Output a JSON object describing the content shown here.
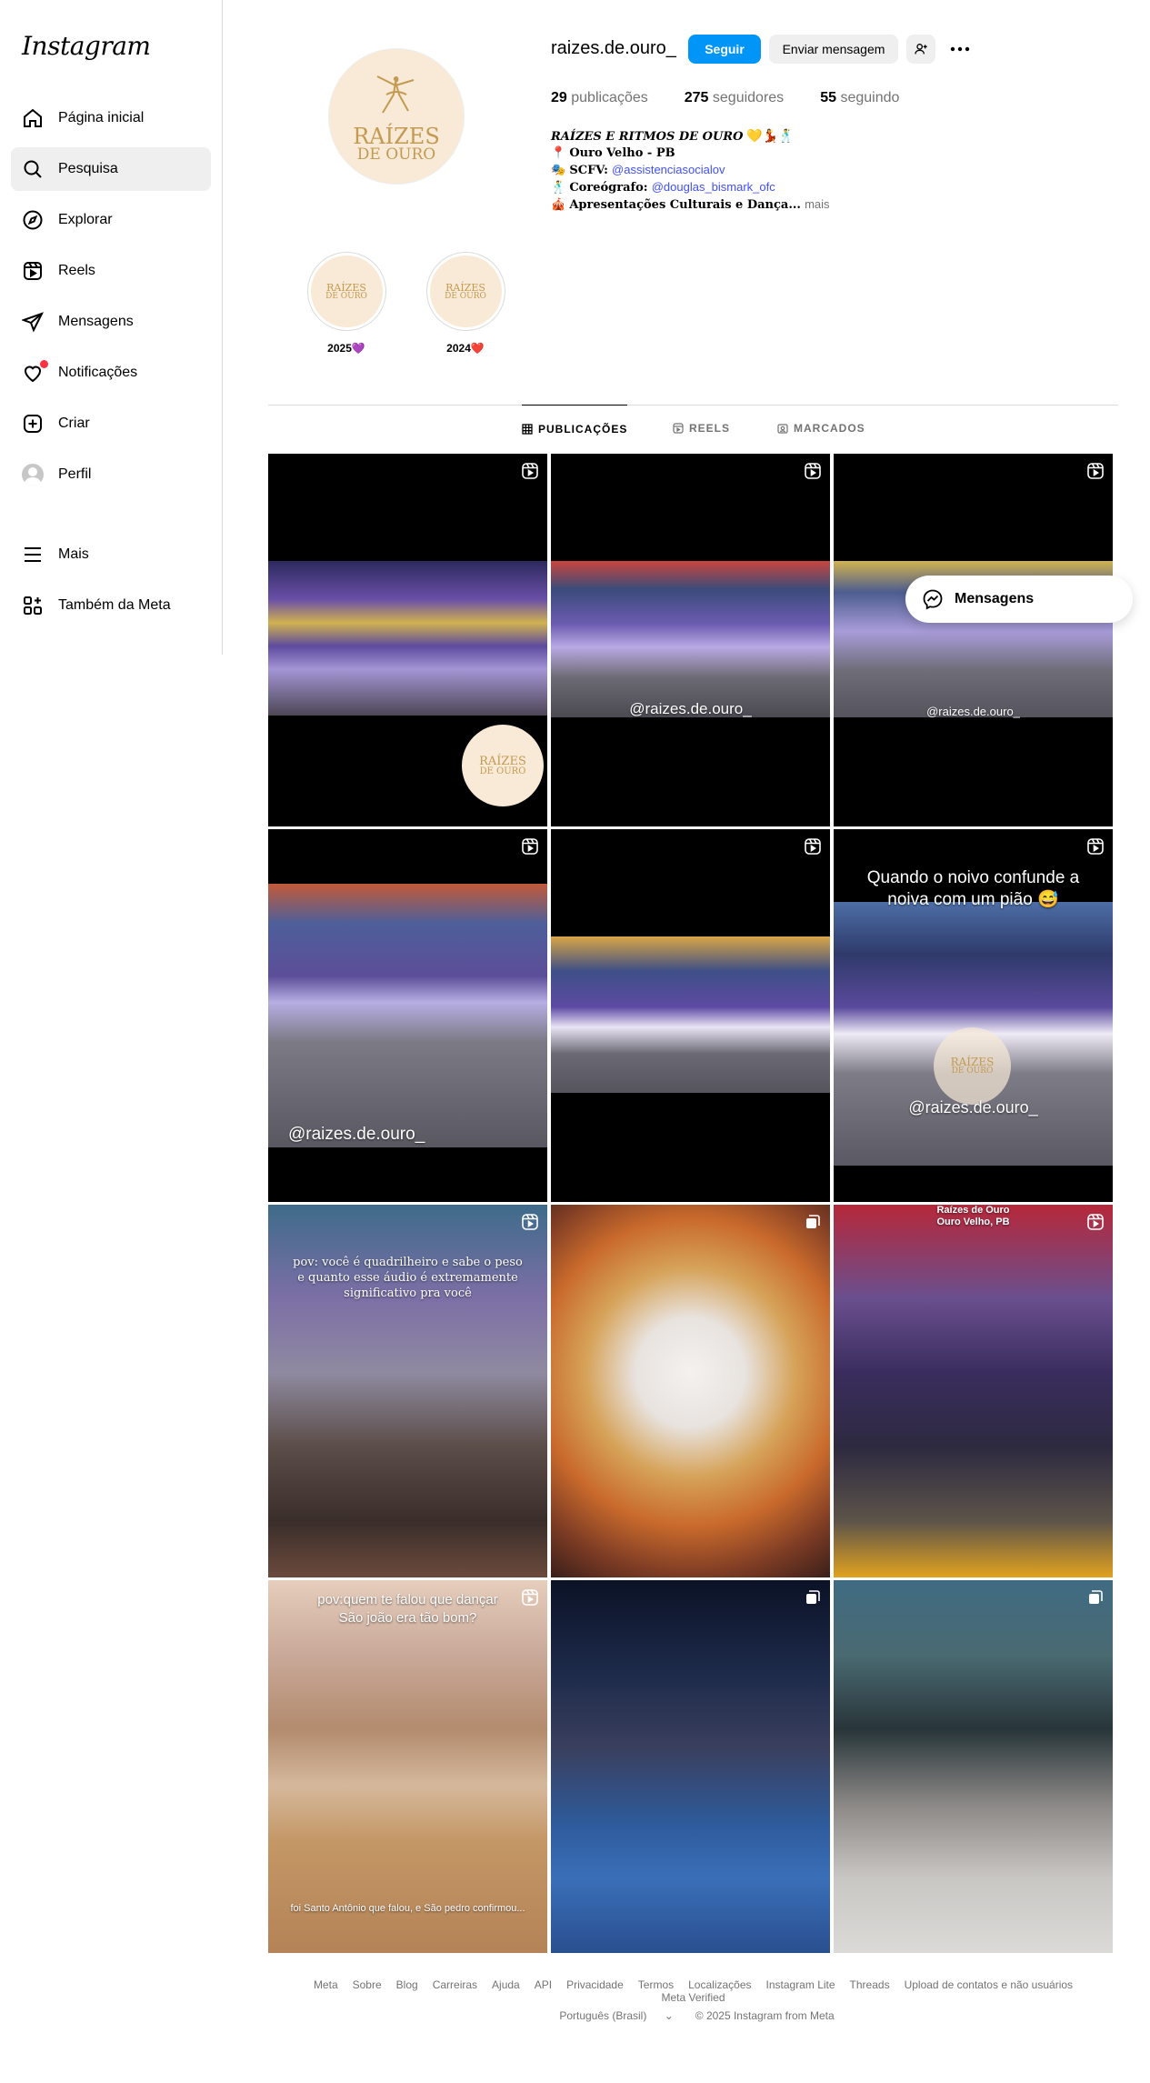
{
  "sidebar": {
    "logo": "Instagram",
    "items": [
      {
        "label": "Página inicial"
      },
      {
        "label": "Pesquisa"
      },
      {
        "label": "Explorar"
      },
      {
        "label": "Reels"
      },
      {
        "label": "Mensagens"
      },
      {
        "label": "Notificações"
      },
      {
        "label": "Criar"
      },
      {
        "label": "Perfil"
      }
    ],
    "more": "Mais",
    "meta": "Também da Meta"
  },
  "profile": {
    "username": "raizes.de.ouro_",
    "follow_label": "Seguir",
    "message_label": "Enviar mensagem",
    "stats": {
      "posts_count": "29",
      "posts_label": "publicações",
      "followers_count": "275",
      "followers_label": "seguidores",
      "following_count": "55",
      "following_label": "seguindo"
    },
    "bio": {
      "title": "RAÍZES E RITMOS DE OURO",
      "title_emojis": "💛💃🕺",
      "line1_icon": "📍",
      "line1": "Ouro Velho - PB",
      "line2_icon": "🎭",
      "line2_prefix": "SCFV:",
      "line2_link": "@assistenciasocialov",
      "line3_icon": "🕺",
      "line3_prefix": "Coreógrafo:",
      "line3_link": "@douglas_bismark_ofc",
      "line4_icon": "🎪",
      "line4": "Apresentações Culturais e Dança...",
      "more": "mais"
    },
    "emblem_line1": "RAÍZES",
    "emblem_line2": "DE OURO"
  },
  "highlights": [
    {
      "label": "2025💜"
    },
    {
      "label": "2024❤️"
    }
  ],
  "tabs": [
    {
      "label": "PUBLICAÇÕES"
    },
    {
      "label": "REELS"
    },
    {
      "label": "MARCADOS"
    }
  ],
  "posts": [
    {
      "overlay_top": "",
      "overlay_bottom": ""
    },
    {
      "overlay_top": "",
      "overlay_bottom": "@raizes.de.ouro_"
    },
    {
      "overlay_top": "",
      "overlay_bottom": "@raizes.de.ouro_"
    },
    {
      "overlay_top": "",
      "overlay_bottom": "@raizes.de.ouro_"
    },
    {
      "overlay_top": "",
      "overlay_bottom": ""
    },
    {
      "overlay_top": "Quando o noivo confunde a noiva com um pião 😅",
      "overlay_bottom": "@raizes.de.ouro_"
    },
    {
      "overlay_top": "pov: você é quadrilheiro e sabe o peso e quanto esse áudio é extremamente significativo pra você",
      "overlay_bottom": ""
    },
    {
      "overlay_top": "",
      "overlay_bottom": ""
    },
    {
      "overlay_top": "Raízes de Ouro\nOuro Velho, PB",
      "overlay_bottom": ""
    },
    {
      "overlay_top": "pov:quem te falou que dançar São joão era tão bom?",
      "overlay_bottom": "foi Santo Antônio que falou, e São pedro confirmou..."
    },
    {
      "overlay_top": "",
      "overlay_bottom": ""
    },
    {
      "overlay_top": "",
      "overlay_bottom": ""
    }
  ],
  "floating_messages": "Mensagens",
  "footer": {
    "links": [
      "Meta",
      "Sobre",
      "Blog",
      "Carreiras",
      "Ajuda",
      "API",
      "Privacidade",
      "Termos",
      "Localizações",
      "Instagram Lite",
      "Threads",
      "Upload de contatos e não usuários",
      "Meta Verified"
    ],
    "language": "Português (Brasil)",
    "copyright": "© 2025 Instagram from Meta"
  },
  "colors": {
    "accent": "#0095f6",
    "link": "#4150f7",
    "notification": "#ff3040",
    "emblem_bg": "#f8ead6",
    "emblem_gold": "#c49a52"
  }
}
